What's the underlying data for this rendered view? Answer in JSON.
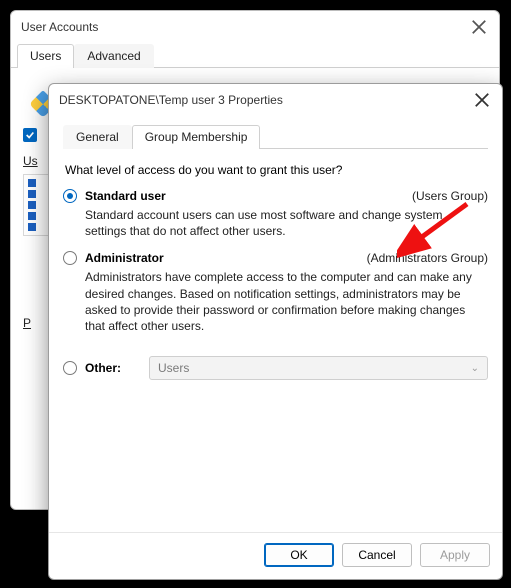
{
  "back_window": {
    "title": "User Accounts",
    "tabs": {
      "users": "Users",
      "advanced": "Advanced"
    },
    "checkbox_partial": "",
    "list_header": "Us"
  },
  "front_window": {
    "title": "DESKTOPATONE\\Temp user 3 Properties",
    "tabs": {
      "general": "General",
      "group": "Group Membership"
    },
    "question": "What level of access do you want to grant this user?",
    "options": {
      "standard": {
        "label": "Standard user",
        "group": "(Users Group)",
        "desc": "Standard account users can use most software and change system settings that do not affect other users."
      },
      "admin": {
        "label": "Administrator",
        "group": "(Administrators Group)",
        "desc": "Administrators have complete access to the computer and can make any desired changes. Based on notification settings, administrators may be asked to provide their password or confirmation before making changes that affect other users."
      },
      "other": {
        "label": "Other:",
        "combo_value": "Users"
      }
    },
    "buttons": {
      "ok": "OK",
      "cancel": "Cancel",
      "apply": "Apply"
    }
  }
}
